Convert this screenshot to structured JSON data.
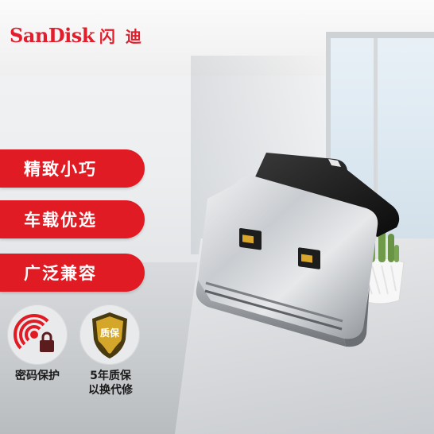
{
  "brand": {
    "name": "SanDisk",
    "cn": "闪 迪",
    "color": "#e21d2c"
  },
  "features": [
    {
      "label": "精致小巧"
    },
    {
      "label": "车载优选"
    },
    {
      "label": "广泛兼容"
    }
  ],
  "badges": [
    {
      "icon": "lock-signal-icon",
      "label": "密码保护"
    },
    {
      "icon": "quality-shield-icon",
      "shield_text": "质保",
      "label_line1": "5年质保",
      "label_line2": "以换代修"
    }
  ],
  "colors": {
    "accent": "#e11b23",
    "badge_bg": "#e9eaec"
  }
}
